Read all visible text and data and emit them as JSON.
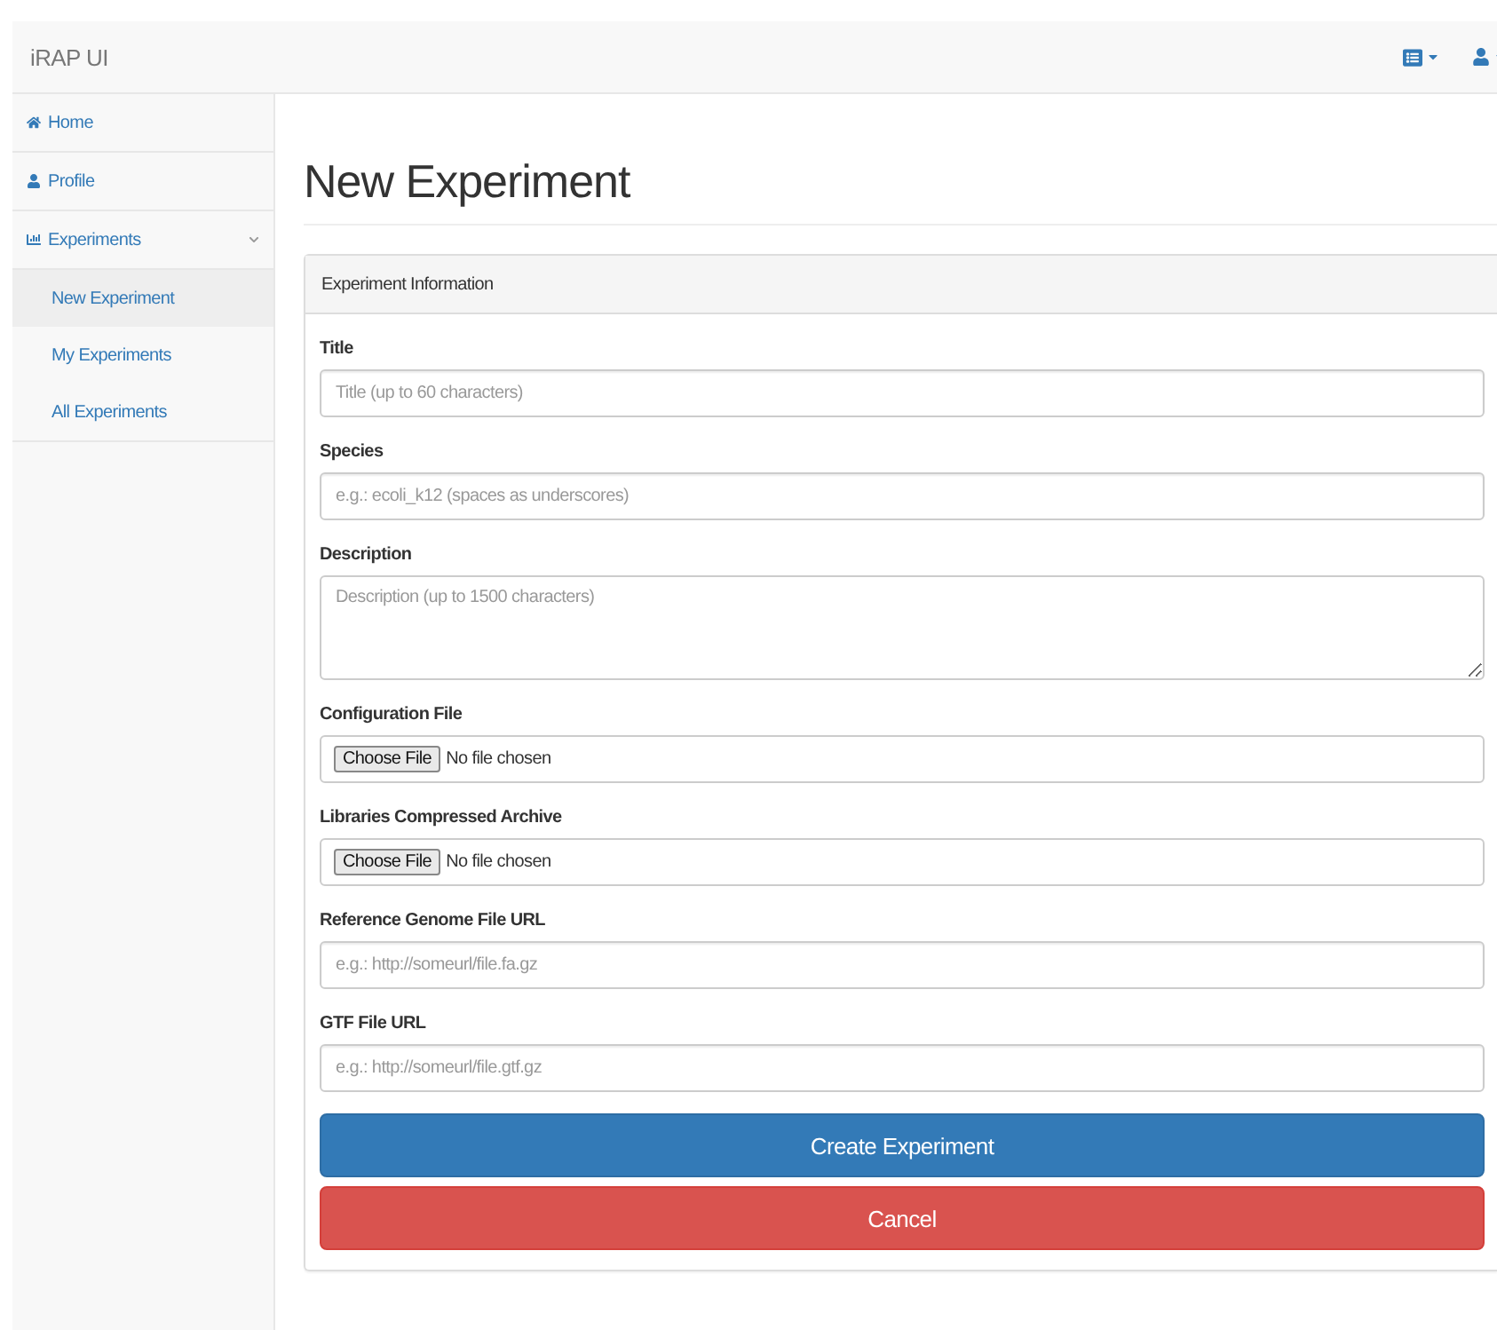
{
  "navbar": {
    "brand": "iRAP UI"
  },
  "sidebar": {
    "items": [
      {
        "label": "Home"
      },
      {
        "label": "Profile"
      },
      {
        "label": "Experiments",
        "expanded": true,
        "children": [
          {
            "label": "New Experiment",
            "selected": true
          },
          {
            "label": "My Experiments",
            "selected": false
          },
          {
            "label": "All Experiments",
            "selected": false
          }
        ]
      }
    ]
  },
  "page": {
    "title": "New Experiment"
  },
  "panel": {
    "heading": "Experiment Information",
    "fields": [
      {
        "kind": "text",
        "label": "Title",
        "placeholder": "Title (up to 60 characters)"
      },
      {
        "kind": "text",
        "label": "Species",
        "placeholder": "e.g.: ecoli_k12 (spaces as underscores)"
      },
      {
        "kind": "textarea",
        "label": "Description",
        "placeholder": "Description (up to 1500 characters)"
      },
      {
        "kind": "file",
        "label": "Configuration File",
        "button": "Choose File",
        "status": "No file chosen"
      },
      {
        "kind": "file",
        "label": "Libraries Compressed Archive",
        "button": "Choose File",
        "status": "No file chosen"
      },
      {
        "kind": "text",
        "label": "Reference Genome File URL",
        "placeholder": "e.g.: http://someurl/file.fa.gz"
      },
      {
        "kind": "text",
        "label": "GTF File URL",
        "placeholder": "e.g.: http://someurl/file.gtf.gz"
      }
    ],
    "buttons": [
      {
        "kind": "primary",
        "label": "Create Experiment"
      },
      {
        "kind": "danger",
        "label": "Cancel"
      }
    ]
  }
}
